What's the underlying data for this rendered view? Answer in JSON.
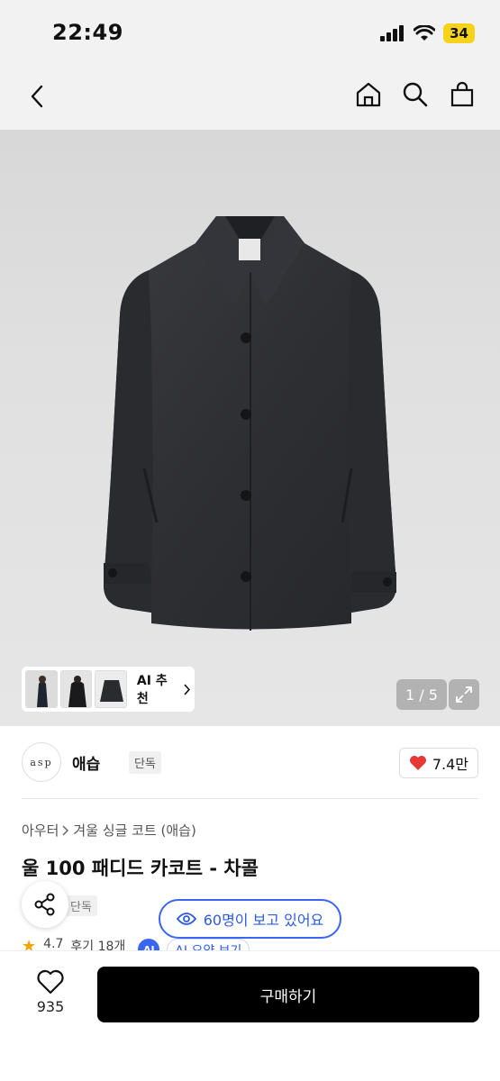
{
  "status": {
    "time": "22:49",
    "battery": "34"
  },
  "nav": {
    "back_icon": "chevron-left-icon",
    "icons": [
      "home-icon",
      "search-icon",
      "bag-icon"
    ]
  },
  "gallery": {
    "page": "1 / 5",
    "ai_recommend": "AI 추천"
  },
  "brand": {
    "logo_text": "asp",
    "name": "애습",
    "tag": "단독",
    "likes": "7.4만"
  },
  "breadcrumb": {
    "category": "아우터",
    "subcategory": "겨울 싱글 코트 (애습)"
  },
  "product": {
    "title": "울 100 패디드 카코트 - 차콜",
    "tag": "단독"
  },
  "viewers": {
    "text": "60명이 보고 있어요"
  },
  "rating": {
    "score": "4.7",
    "reviews": "후기 18개",
    "ai_badge": "AI",
    "ai_summary": "AI 요약 보기"
  },
  "bottom": {
    "wish_count": "935",
    "buy_label": "구매하기"
  },
  "colors": {
    "accent_blue": "#3a66f0",
    "heart_red": "#e53935",
    "buy_black": "#000000"
  }
}
